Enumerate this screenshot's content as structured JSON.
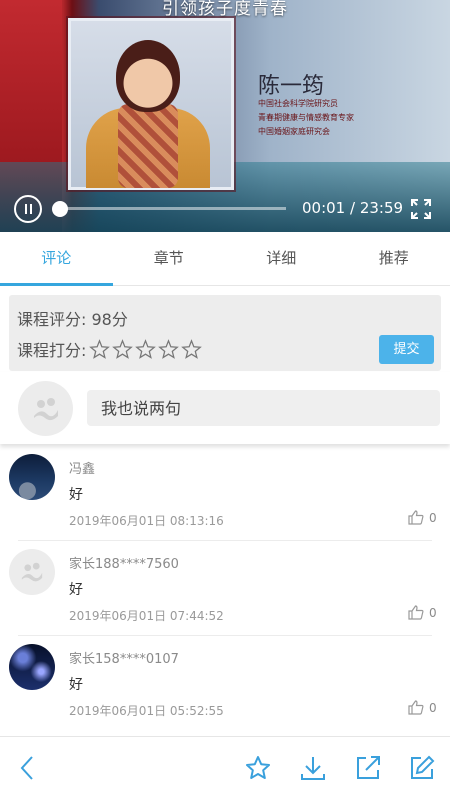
{
  "video": {
    "title": "引领孩子度青春",
    "speaker_name": "陈一筠",
    "speaker_titles": [
      "中国社会科学院研究员",
      "青春期健康与情感教育专家",
      "中国婚姻家庭研究会"
    ],
    "time": "00:01 / 23:59",
    "progress_fraction": 0.0007
  },
  "tabs": [
    {
      "label": "评论",
      "active": true
    },
    {
      "label": "章节",
      "active": false
    },
    {
      "label": "详细",
      "active": false
    },
    {
      "label": "推荐",
      "active": false
    }
  ],
  "rating": {
    "score_label": "课程评分: 98分",
    "rate_label": "课程打分:",
    "stars_total": 5,
    "stars_selected": 0,
    "submit_label": "提交"
  },
  "comment_input": {
    "placeholder": "我也说两句"
  },
  "comments": [
    {
      "name": "冯鑫",
      "text": "好",
      "time": "2019年06月01日 08:13:16",
      "likes": "0"
    },
    {
      "name": "家长188****7560",
      "text": "好",
      "time": "2019年06月01日 07:44:52",
      "likes": "0"
    },
    {
      "name": "家长158****0107",
      "text": "好",
      "time": "2019年06月01日 05:52:55",
      "likes": "0"
    }
  ],
  "colors": {
    "accent": "#35a6de",
    "submit_button": "#4cb3ea"
  },
  "toolbar": {
    "icons": [
      "back-icon",
      "star-icon",
      "download-icon",
      "share-icon",
      "edit-icon"
    ]
  }
}
